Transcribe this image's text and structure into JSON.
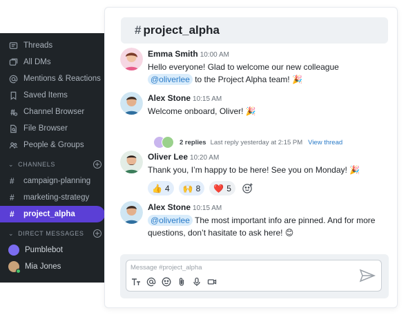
{
  "sidebar": {
    "nav": [
      {
        "label": "Threads",
        "icon": "threads-icon"
      },
      {
        "label": "All DMs",
        "icon": "all-dms-icon"
      },
      {
        "label": "Mentions & Reactions",
        "icon": "at-sign-icon"
      },
      {
        "label": "Saved Items",
        "icon": "bookmark-icon"
      },
      {
        "label": "Channel Browser",
        "icon": "channel-browser-icon"
      },
      {
        "label": "File Browser",
        "icon": "file-search-icon"
      },
      {
        "label": "People & Groups",
        "icon": "people-icon"
      }
    ],
    "channels_title": "CHANNELS",
    "channels": [
      {
        "label": "campaign-planning"
      },
      {
        "label": "marketing-strategy"
      },
      {
        "label": "project_alpha",
        "active": true
      }
    ],
    "dms_title": "DIRECT MESSAGES",
    "dms": [
      {
        "label": "Pumblebot"
      },
      {
        "label": "Mia Jones"
      }
    ]
  },
  "header": {
    "hash": "#",
    "channel_name": "project_alpha"
  },
  "messages": [
    {
      "author": "Emma Smith",
      "time": "10:00 AM",
      "text_before": "Hello everyone! Glad to welcome our new colleague ",
      "mention": "@oliverlee",
      "text_after": " to the Project Alpha team! 🎉"
    },
    {
      "author": "Alex Stone",
      "time": "10:15 AM",
      "text": "Welcome onboard, Oliver! 🎉"
    },
    {
      "author": "Oliver Lee",
      "time": "10:20 AM",
      "text": "Thank you, I’m happy to be here! See you on Monday! 🎉"
    },
    {
      "author": "Alex Stone",
      "time": "10:15 AM",
      "mention": "@oliverlee",
      "text_after": " The most important info are pinned. And for more questions, don’t hasitate to ask here! 😊"
    }
  ],
  "thread": {
    "replies": "2 replies",
    "last_reply": "Last reply yesterday at 2:15 PM",
    "view": "View thread"
  },
  "reactions": [
    {
      "emoji": "👍",
      "count": "4"
    },
    {
      "emoji": "🙌",
      "count": "8"
    },
    {
      "emoji": "❤️",
      "count": "5"
    }
  ],
  "composer": {
    "placeholder": "Message #project_alpha"
  },
  "colors": {
    "sidebar_bg": "#1f2428",
    "active_channel": "#5b3fd6",
    "mention_bg": "#d9ecfb",
    "link": "#2a7bc8"
  }
}
